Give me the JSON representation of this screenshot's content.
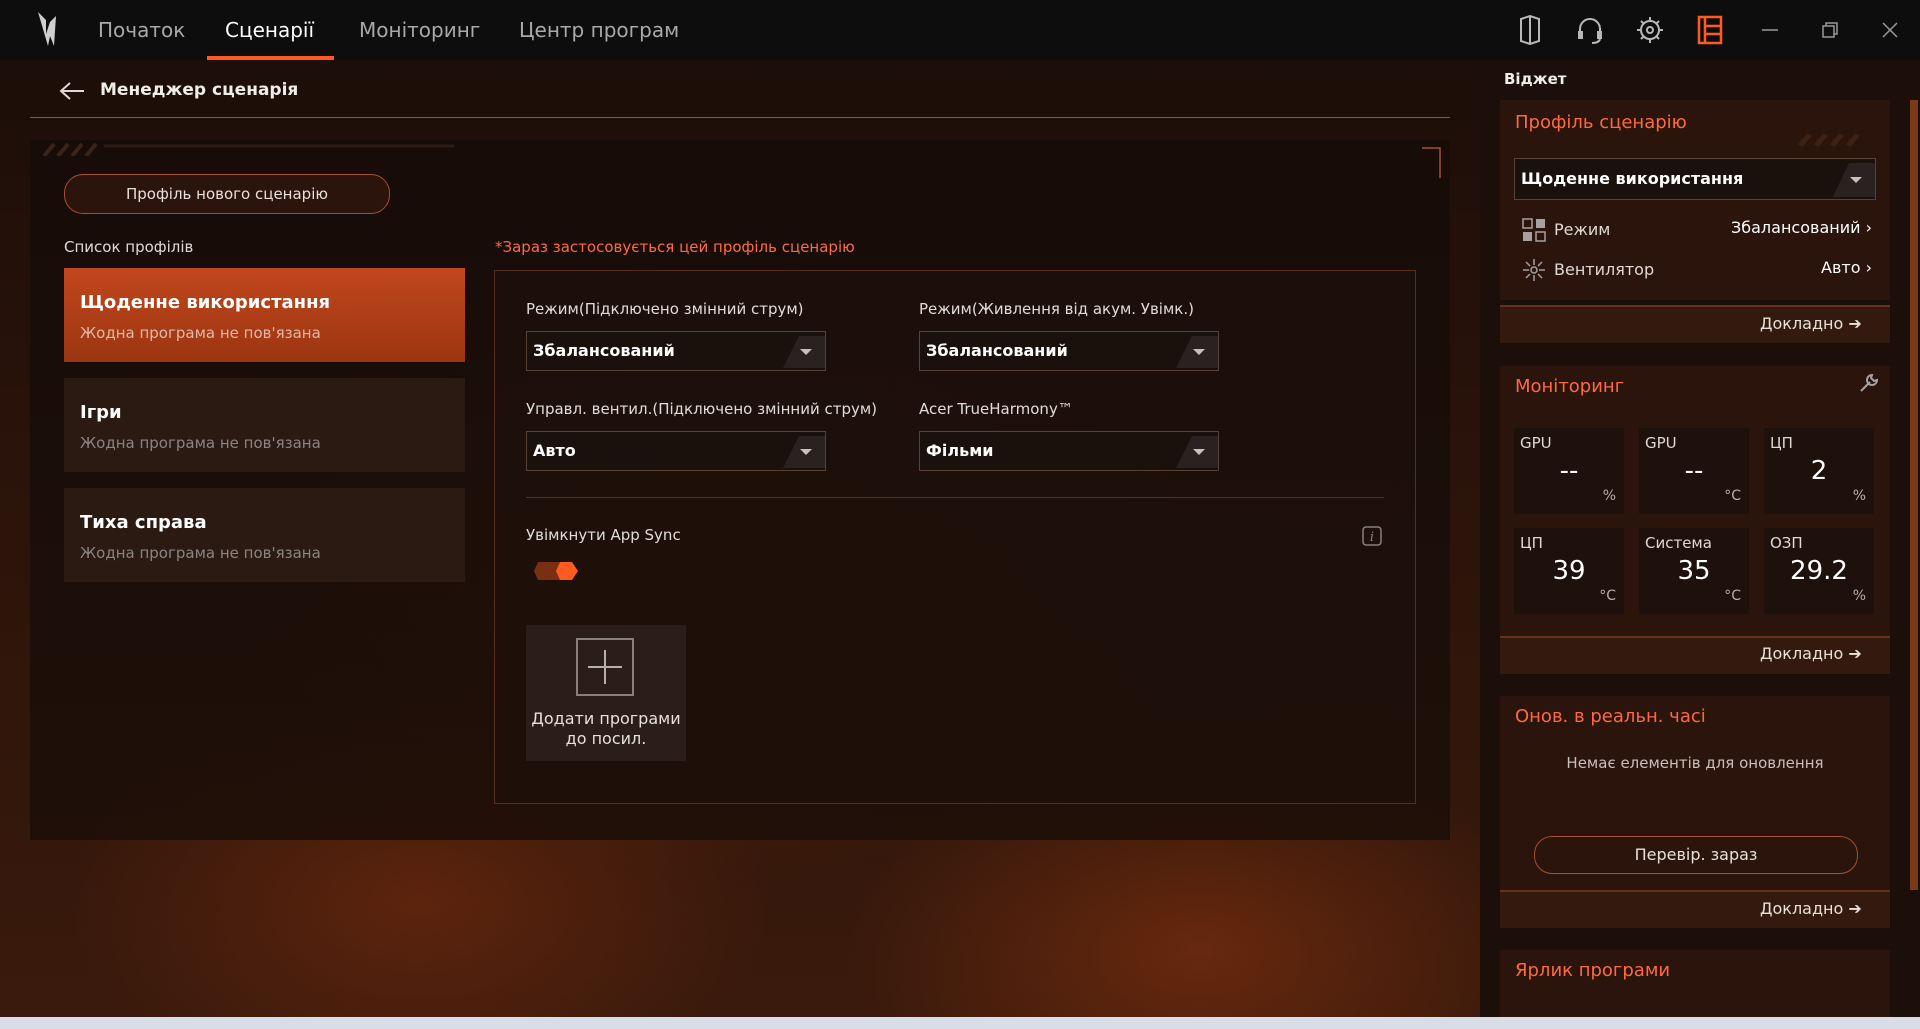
{
  "nav": {
    "tabs": [
      {
        "label": "Початок"
      },
      {
        "label": "Сценарії"
      },
      {
        "label": "Моніторинг"
      },
      {
        "label": "Центр програм"
      }
    ]
  },
  "page": {
    "title": "Менеджер сценарія",
    "new_profile_button": "Профіль нового сценарію",
    "profiles_label": "Список профілів",
    "applied_note": "*Зараз застосовується цей профіль сценарію"
  },
  "profiles": [
    {
      "name": "Щоденне використання",
      "sub": "Жодна програма не пов'язана"
    },
    {
      "name": "Ігри",
      "sub": "Жодна програма не пов'язана"
    },
    {
      "name": "Тиха справа",
      "sub": "Жодна програма не пов'язана"
    }
  ],
  "settings": {
    "mode_ac_label": "Режим(Підключено змінний струм)",
    "mode_ac_value": "Збалансований",
    "mode_battery_label": "Режим(Живлення від акум. Увімк.)",
    "mode_battery_value": "Збалансований",
    "fan_ac_label": "Управл. вентил.(Підключено змінний струм)",
    "fan_ac_value": "Авто",
    "trueharmony_label": "Acer TrueHarmony™",
    "trueharmony_value": "Фільми",
    "app_sync_label": "Увімкнути App Sync",
    "add_apps_line1": "Додати програми",
    "add_apps_line2": "до посил."
  },
  "widget": {
    "label": "Віджет",
    "profile_card": {
      "title": "Профіль сценарію",
      "selected": "Щоденне використання",
      "mode_label": "Режим",
      "mode_value": "Збалансований",
      "fan_label": "Вентилятор",
      "fan_value": "Авто",
      "more": "Докладно"
    },
    "monitor_card": {
      "title": "Моніторинг",
      "cells": [
        {
          "label": "GPU",
          "value": "--",
          "unit": "%"
        },
        {
          "label": "GPU",
          "value": "--",
          "unit": "°C"
        },
        {
          "label": "ЦП",
          "value": "2",
          "unit": "%"
        },
        {
          "label": "ЦП",
          "value": "39",
          "unit": "°C"
        },
        {
          "label": "Система",
          "value": "35",
          "unit": "°C"
        },
        {
          "label": "ОЗП",
          "value": "29.2",
          "unit": "%"
        }
      ],
      "more": "Докладно"
    },
    "update_card": {
      "title": "Онов. в реальн. часі",
      "empty": "Немає елементів для оновлення",
      "check_button": "Перевір. зараз",
      "more": "Докладно"
    },
    "shortcut_card": {
      "title": "Ярлик програми"
    }
  },
  "colors": {
    "accent": "#ff5a1f",
    "accent_text": "#ff6a3a"
  }
}
